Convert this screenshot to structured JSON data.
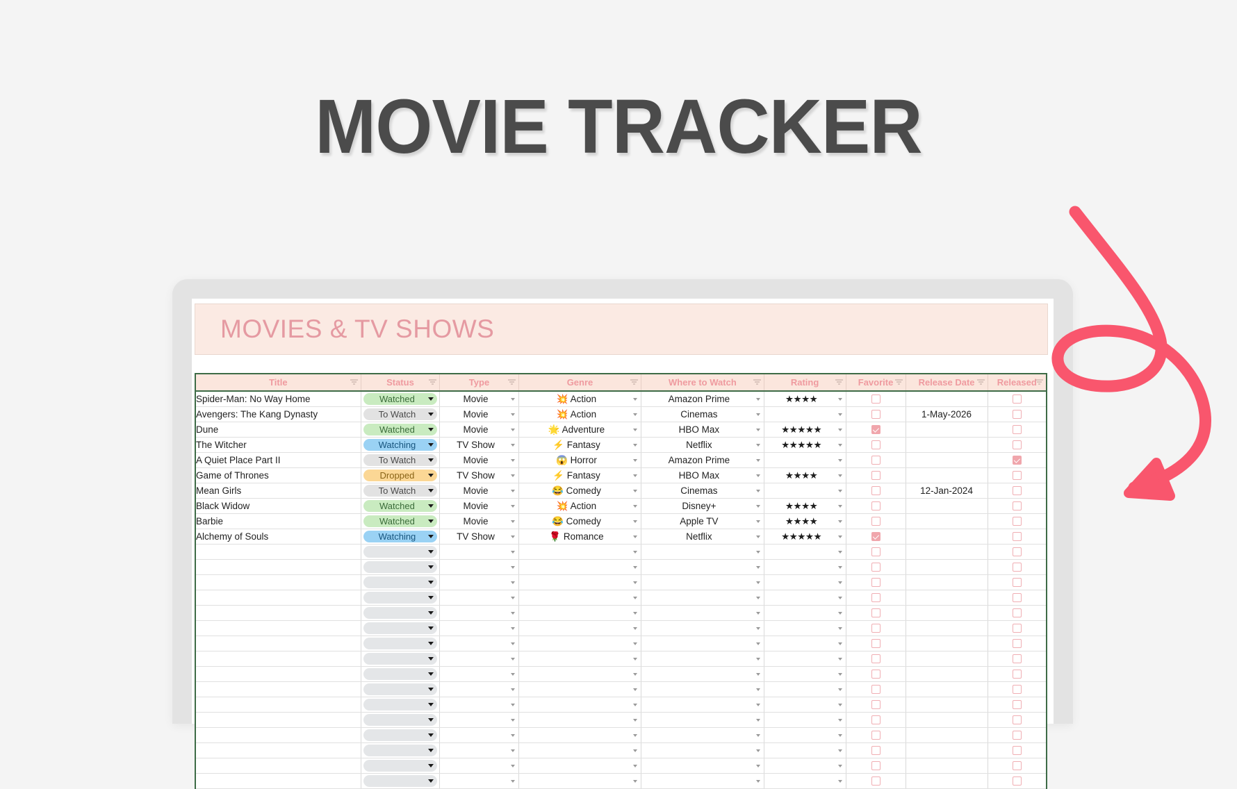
{
  "page": {
    "heading": "MOVIE TRACKER",
    "background_color": "#f4f4f4",
    "heading_color": "#4b4b4b"
  },
  "decor": {
    "arrow": {
      "name": "curved-loop-arrow",
      "color": "#f9566d"
    }
  },
  "spreadsheet": {
    "banner_title": "MOVIES & TV SHOWS",
    "banner_bg": "#fbeae3",
    "banner_text_color": "#e59aa2",
    "header_bg": "#fbe6dd",
    "header_text_color": "#ef9a9f",
    "grid_border_color": "#3d6b46",
    "filter_icon": "filter-funnel-icon",
    "columns": [
      {
        "key": "title",
        "label": "Title"
      },
      {
        "key": "status",
        "label": "Status"
      },
      {
        "key": "type",
        "label": "Type"
      },
      {
        "key": "genre",
        "label": "Genre"
      },
      {
        "key": "where",
        "label": "Where to Watch"
      },
      {
        "key": "rating",
        "label": "Rating"
      },
      {
        "key": "favorite",
        "label": "Favorite"
      },
      {
        "key": "date",
        "label": "Release Date"
      },
      {
        "key": "released",
        "label": "Released"
      }
    ],
    "status_colors": {
      "Watched": "#c9ebc0",
      "To Watch": "#e2e2e2",
      "Watching": "#9ad2f4",
      "Dropped": "#fbd795"
    },
    "star_color": "#fbbd3b",
    "checkbox_color": "#f0a6ac",
    "rows": [
      {
        "title": "Spider-Man: No Way Home",
        "status": "Watched",
        "type": "Movie",
        "genre_emoji": "💥",
        "genre": "Action",
        "where": "Amazon Prime",
        "rating": 4,
        "favorite": false,
        "date": "",
        "released": false
      },
      {
        "title": "Avengers: The Kang Dynasty",
        "status": "To Watch",
        "type": "Movie",
        "genre_emoji": "💥",
        "genre": "Action",
        "where": "Cinemas",
        "rating": 0,
        "favorite": false,
        "date": "1-May-2026",
        "released": false
      },
      {
        "title": "Dune",
        "status": "Watched",
        "type": "Movie",
        "genre_emoji": "🌟",
        "genre": "Adventure",
        "where": "HBO Max",
        "rating": 5,
        "favorite": true,
        "date": "",
        "released": false
      },
      {
        "title": "The Witcher",
        "status": "Watching",
        "type": "TV Show",
        "genre_emoji": "⚡",
        "genre": "Fantasy",
        "where": "Netflix",
        "rating": 5,
        "favorite": false,
        "date": "",
        "released": false
      },
      {
        "title": "A Quiet Place Part II",
        "status": "To Watch",
        "type": "Movie",
        "genre_emoji": "😱",
        "genre": "Horror",
        "where": "Amazon Prime",
        "rating": 0,
        "favorite": false,
        "date": "",
        "released": true
      },
      {
        "title": "Game of Thrones",
        "status": "Dropped",
        "type": "TV Show",
        "genre_emoji": "⚡",
        "genre": "Fantasy",
        "where": "HBO Max",
        "rating": 4,
        "favorite": false,
        "date": "",
        "released": false
      },
      {
        "title": "Mean Girls",
        "status": "To Watch",
        "type": "Movie",
        "genre_emoji": "😂",
        "genre": "Comedy",
        "where": "Cinemas",
        "rating": 0,
        "favorite": false,
        "date": "12-Jan-2024",
        "released": false
      },
      {
        "title": "Black Widow",
        "status": "Watched",
        "type": "Movie",
        "genre_emoji": "💥",
        "genre": "Action",
        "where": "Disney+",
        "rating": 4,
        "favorite": false,
        "date": "",
        "released": false
      },
      {
        "title": "Barbie",
        "status": "Watched",
        "type": "Movie",
        "genre_emoji": "😂",
        "genre": "Comedy",
        "where": "Apple TV",
        "rating": 4,
        "favorite": false,
        "date": "",
        "released": false
      },
      {
        "title": "Alchemy of Souls",
        "status": "Watching",
        "type": "TV Show",
        "genre_emoji": "🌹",
        "genre": "Romance",
        "where": "Netflix",
        "rating": 5,
        "favorite": true,
        "date": "",
        "released": false
      }
    ],
    "empty_row_count": 16
  }
}
